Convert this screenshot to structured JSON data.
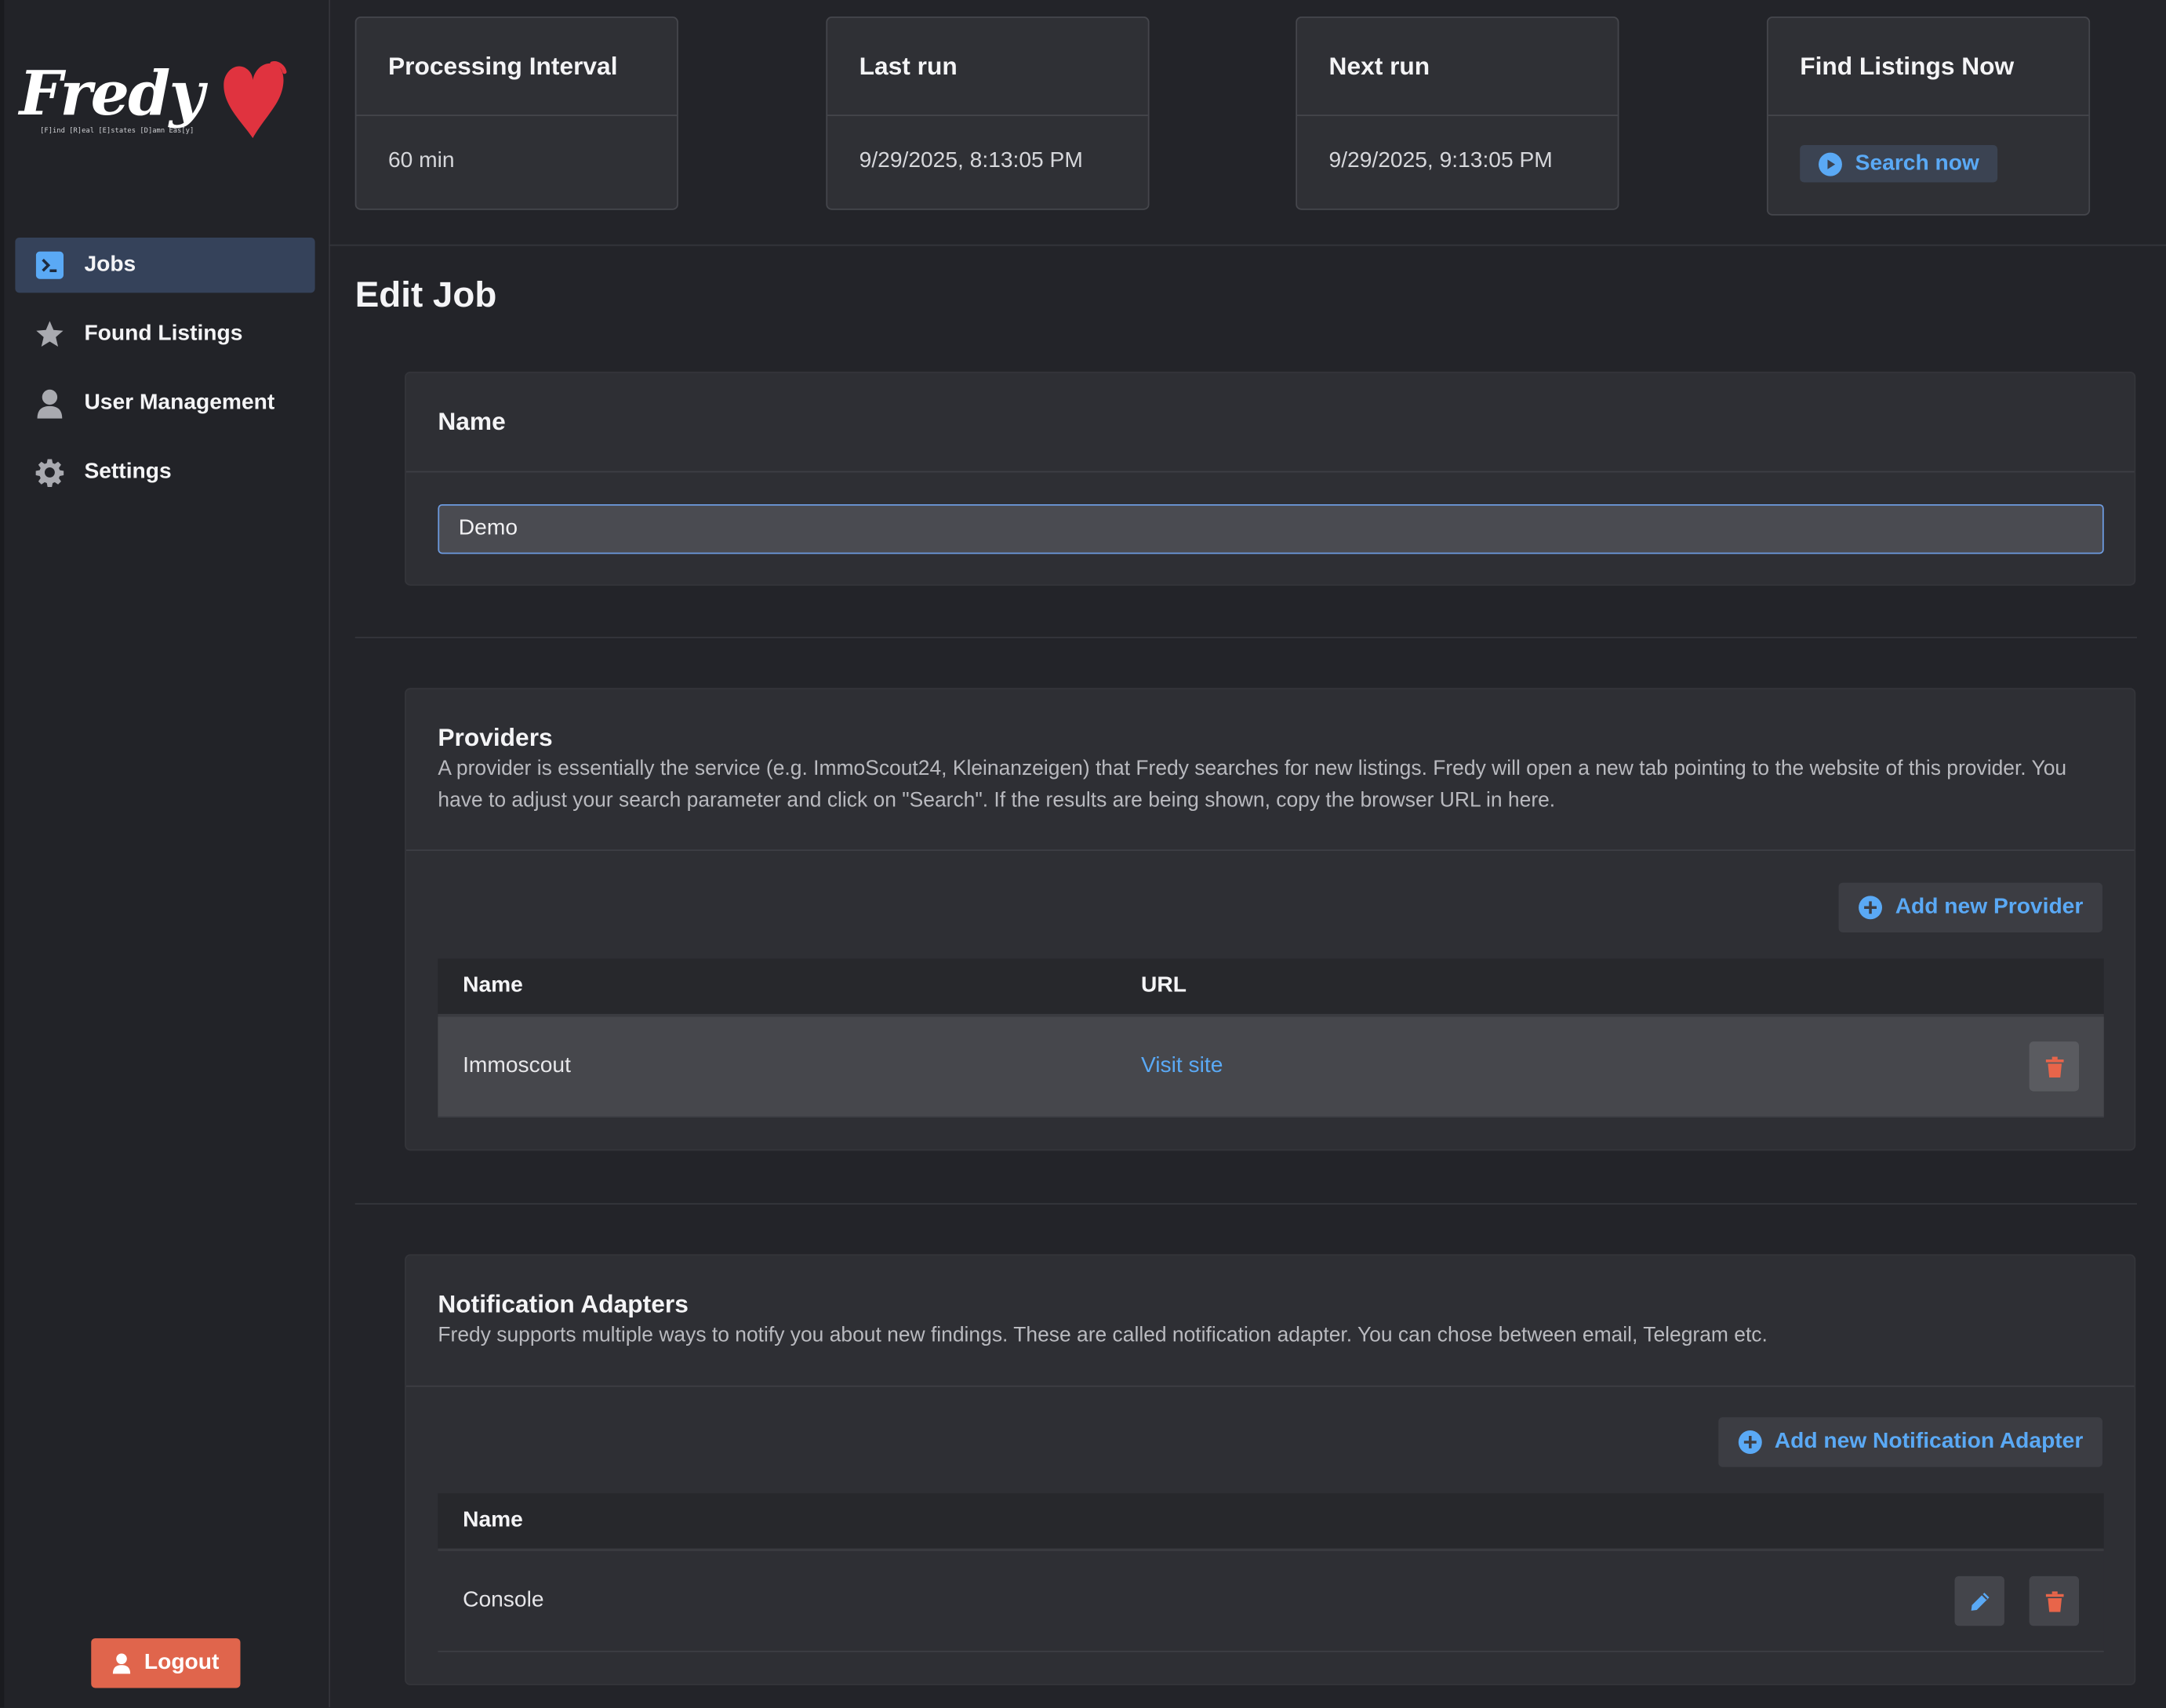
{
  "sidebar": {
    "logo_text": "Fredy",
    "logo_tagline": "[F]ind [R]eal [E]states [D]amn Eas[y]",
    "nav": [
      {
        "label": "Jobs",
        "icon": "terminal-icon",
        "active": true
      },
      {
        "label": "Found Listings",
        "icon": "star-icon",
        "active": false
      },
      {
        "label": "User Management",
        "icon": "user-icon",
        "active": false
      },
      {
        "label": "Settings",
        "icon": "gear-icon",
        "active": false
      }
    ],
    "logout_label": "Logout"
  },
  "stats": {
    "processing_interval": {
      "title": "Processing Interval",
      "value": "60 min"
    },
    "last_run": {
      "title": "Last run",
      "value": "9/29/2025, 8:13:05 PM"
    },
    "next_run": {
      "title": "Next run",
      "value": "9/29/2025, 9:13:05 PM"
    },
    "find_listings": {
      "title": "Find Listings Now",
      "button_label": "Search now"
    }
  },
  "page_title": "Edit Job",
  "name_section": {
    "title": "Name",
    "input_value": "Demo"
  },
  "providers": {
    "title": "Providers",
    "description": "A provider is essentially the service (e.g. ImmoScout24, Kleinanzeigen) that Fredy searches for new listings. Fredy will open a new tab pointing to the website of this provider. You have to adjust your search parameter and click on \"Search\". If the results are being shown, copy the browser URL in here.",
    "add_label": "Add new Provider",
    "columns": [
      "Name",
      "URL"
    ],
    "rows": [
      {
        "name": "Immoscout",
        "url_label": "Visit site"
      }
    ]
  },
  "notification_adapters": {
    "title": "Notification Adapters",
    "description": "Fredy supports multiple ways to notify you about new findings. These are called notification adapter. You can chose between email, Telegram etc.",
    "add_label": "Add new Notification Adapter",
    "columns": [
      "Name"
    ],
    "rows": [
      {
        "name": "Console"
      }
    ]
  },
  "colors": {
    "accent": "#5aa9f5",
    "danger": "#e0654c",
    "active_nav": "#35425a",
    "heart": "#e0333f"
  }
}
